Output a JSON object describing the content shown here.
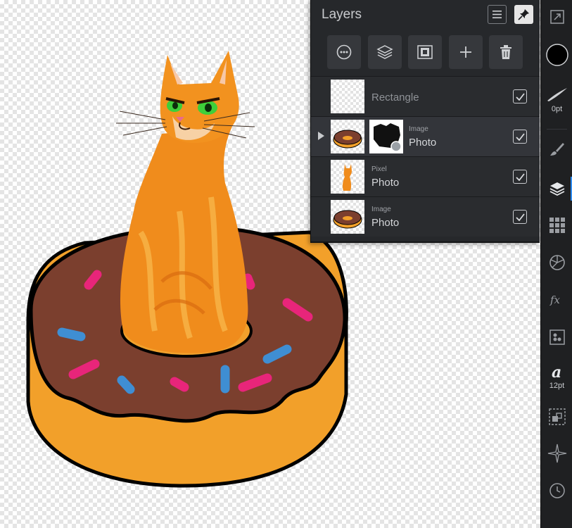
{
  "layers_panel": {
    "title": "Layers",
    "actions": [
      {
        "icon": "more-options-icon"
      },
      {
        "icon": "layer-stack-icon"
      },
      {
        "icon": "mask-icon"
      },
      {
        "icon": "add-icon"
      },
      {
        "icon": "trash-icon"
      }
    ],
    "layers": [
      {
        "kind": "",
        "name": "Rectangle",
        "visible": true,
        "thumbnail": "empty-transparent"
      },
      {
        "kind": "Image",
        "name": "Photo",
        "visible": true,
        "thumbnail": "donut",
        "mask": true,
        "expandable": true
      },
      {
        "kind": "Pixel",
        "name": "Photo",
        "visible": true,
        "thumbnail": "cat"
      },
      {
        "kind": "Image",
        "name": "Photo",
        "visible": true,
        "thumbnail": "donut"
      }
    ]
  },
  "toolbar": {
    "stroke_width": "0pt",
    "font_size": "12pt",
    "items": [
      "color-swatch-icon",
      "stroke-brush-icon",
      "brush-icon",
      "layers-icon",
      "grid-icon",
      "color-wheel-icon",
      "fx-icon",
      "channels-icon",
      "text-style-icon",
      "transform-icon",
      "navigator-icon",
      "history-icon"
    ],
    "active": "layers-icon"
  },
  "colors": {
    "accent": "#2f8cf0",
    "panel_bg": "#26282b",
    "donut_icing": "#7a3c2b",
    "donut_dough": "#f29b26",
    "cat_orange": "#f0901e"
  }
}
